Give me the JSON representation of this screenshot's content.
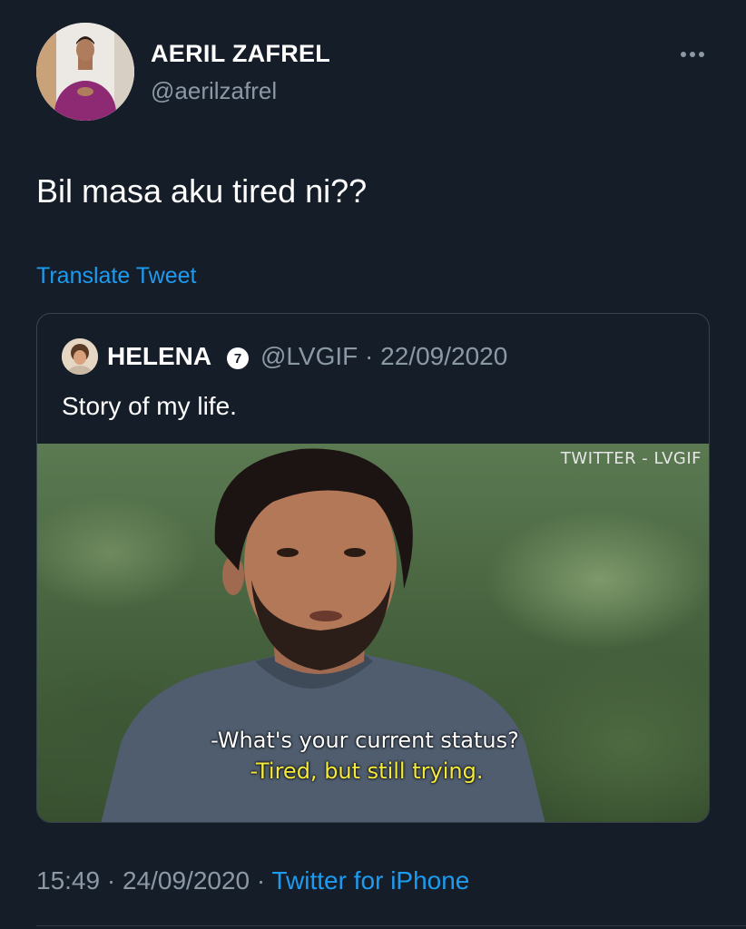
{
  "tweet": {
    "display_name": "AERIL ZAFREL",
    "handle": "@aerilzafrel",
    "text": "Bil masa aku tired ni??",
    "translate_label": "Translate Tweet",
    "time": "15:49",
    "separator": "·",
    "date": "24/09/2020",
    "source": "Twitter for iPhone"
  },
  "quoted_tweet": {
    "display_name": "HELENA",
    "badge": "7",
    "handle": "@LVGIF",
    "separator": "·",
    "date": "22/09/2020",
    "text": "Story of my life.",
    "media": {
      "watermark": "TWITTER - LVGIF",
      "subtitle_line1": "-What's your current status?",
      "subtitle_line2": "-Tired, but still trying."
    }
  },
  "icons": {
    "more": "more-horizontal-icon",
    "badge": "number-badge-icon"
  },
  "colors": {
    "background": "#151d28",
    "link": "#1d9bf0",
    "secondary_text": "#8b98a5",
    "subtitle_yellow": "#f5ea3c"
  }
}
